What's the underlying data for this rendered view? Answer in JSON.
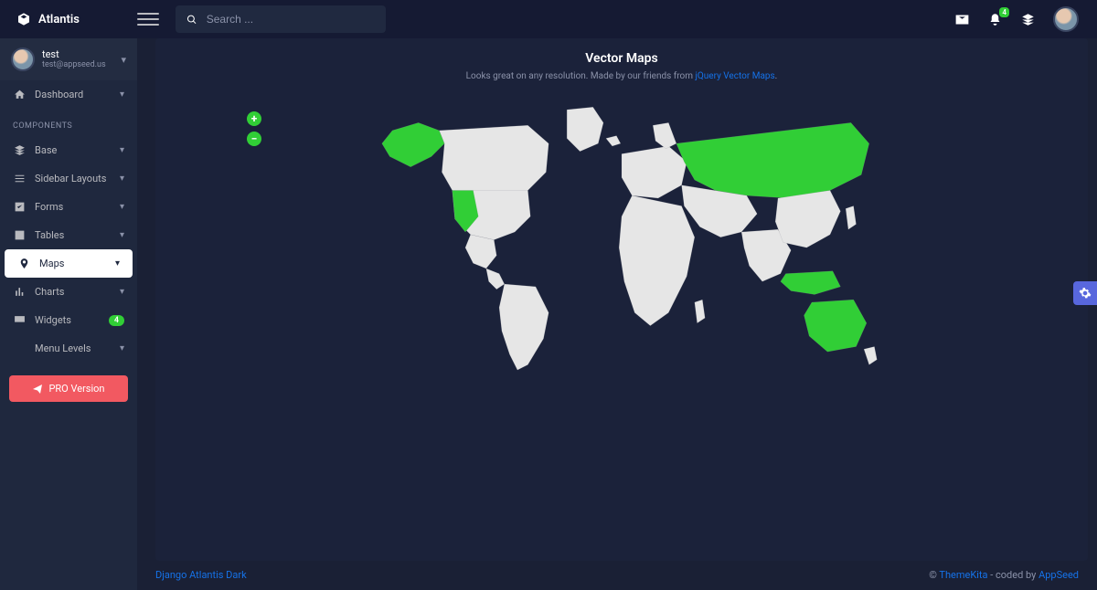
{
  "brand": {
    "name": "Atlantis"
  },
  "search": {
    "placeholder": "Search ..."
  },
  "notifications": {
    "count": "4"
  },
  "user": {
    "name": "test",
    "email": "test@appseed.us"
  },
  "sidebar": {
    "dashboard": "Dashboard",
    "section": "COMPONENTS",
    "items": [
      {
        "label": "Base"
      },
      {
        "label": "Sidebar Layouts"
      },
      {
        "label": "Forms"
      },
      {
        "label": "Tables"
      },
      {
        "label": "Maps"
      },
      {
        "label": "Charts"
      },
      {
        "label": "Widgets",
        "badge": "4"
      },
      {
        "label": "Menu Levels"
      }
    ],
    "pro": "PRO Version"
  },
  "page": {
    "title": "Vector Maps",
    "subtitle_prefix": "Looks great on any resolution. Made by our friends from ",
    "subtitle_link": "jQuery Vector Maps",
    "subtitle_suffix": "."
  },
  "map": {
    "highlighted_regions": [
      "Alaska",
      "US West Coast",
      "Russia",
      "Indonesia",
      "Australia"
    ]
  },
  "footer": {
    "left_link": "Django Atlantis Dark",
    "right_prefix": "© ",
    "right_link1": "ThemeKita",
    "right_mid": " - coded by ",
    "right_link2": "AppSeed"
  }
}
